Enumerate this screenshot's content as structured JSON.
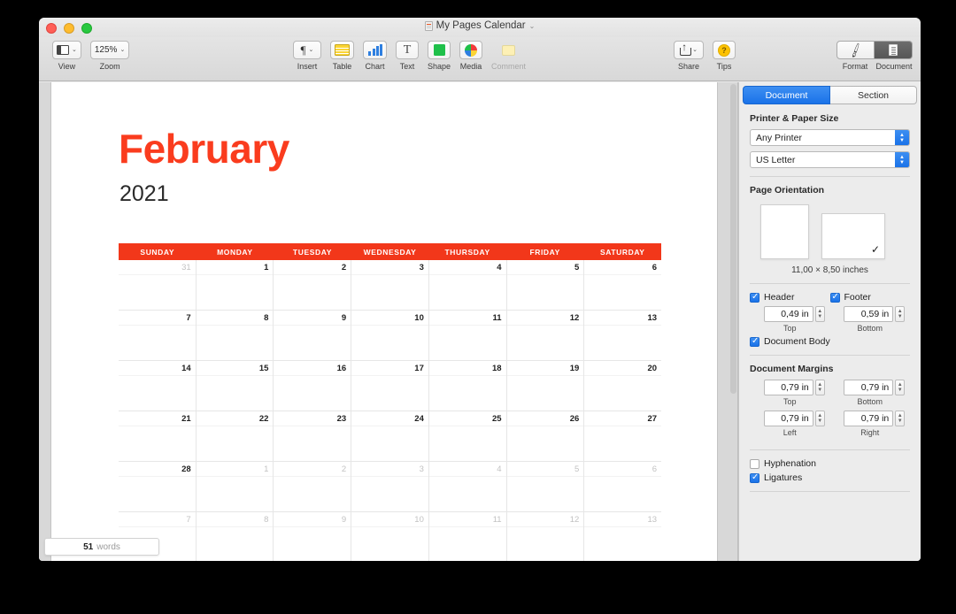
{
  "window": {
    "title": "My Pages Calendar",
    "title_chevron": "⌄"
  },
  "toolbar": {
    "left": [
      {
        "name": "view",
        "label": "View",
        "chevron": "⌄"
      },
      {
        "name": "zoom",
        "label": "Zoom",
        "value": "125%",
        "chevron": "⌄"
      }
    ],
    "center": [
      {
        "name": "insert",
        "label": "Insert",
        "chevron": "⌄"
      },
      {
        "name": "table",
        "label": "Table"
      },
      {
        "name": "chart",
        "label": "Chart"
      },
      {
        "name": "text",
        "label": "Text",
        "glyph": "T"
      },
      {
        "name": "shape",
        "label": "Shape"
      },
      {
        "name": "media",
        "label": "Media"
      },
      {
        "name": "comment",
        "label": "Comment",
        "dimmed": true
      }
    ],
    "right": [
      {
        "name": "share",
        "label": "Share",
        "chevron": "⌄"
      },
      {
        "name": "tips",
        "label": "Tips",
        "glyph": "?"
      }
    ],
    "inspector_toggle": {
      "format_label": "Format",
      "document_label": "Document",
      "active": "Document"
    }
  },
  "document": {
    "month": "February",
    "year": "2021",
    "weekdays": [
      "SUNDAY",
      "MONDAY",
      "TUESDAY",
      "WEDNESDAY",
      "THURSDAY",
      "FRIDAY",
      "SATURDAY"
    ],
    "weeks": [
      [
        {
          "n": "31",
          "other": true
        },
        {
          "n": "1"
        },
        {
          "n": "2"
        },
        {
          "n": "3"
        },
        {
          "n": "4"
        },
        {
          "n": "5"
        },
        {
          "n": "6"
        }
      ],
      [
        {
          "n": "7"
        },
        {
          "n": "8"
        },
        {
          "n": "9"
        },
        {
          "n": "10"
        },
        {
          "n": "11"
        },
        {
          "n": "12"
        },
        {
          "n": "13"
        }
      ],
      [
        {
          "n": "14"
        },
        {
          "n": "15"
        },
        {
          "n": "16"
        },
        {
          "n": "17"
        },
        {
          "n": "18"
        },
        {
          "n": "19"
        },
        {
          "n": "20"
        }
      ],
      [
        {
          "n": "21"
        },
        {
          "n": "22"
        },
        {
          "n": "23"
        },
        {
          "n": "24"
        },
        {
          "n": "25"
        },
        {
          "n": "26"
        },
        {
          "n": "27"
        }
      ],
      [
        {
          "n": "28"
        },
        {
          "n": "1",
          "other": true
        },
        {
          "n": "2",
          "other": true
        },
        {
          "n": "3",
          "other": true
        },
        {
          "n": "4",
          "other": true
        },
        {
          "n": "5",
          "other": true
        },
        {
          "n": "6",
          "other": true
        }
      ],
      [
        {
          "n": "7",
          "other": true
        },
        {
          "n": "8",
          "other": true
        },
        {
          "n": "9",
          "other": true
        },
        {
          "n": "10",
          "other": true
        },
        {
          "n": "11",
          "other": true
        },
        {
          "n": "12",
          "other": true
        },
        {
          "n": "13",
          "other": true
        }
      ]
    ],
    "accent_color": "#f2371a",
    "title_color": "#fa3c1e"
  },
  "wordcount": {
    "count": "51",
    "label": "words"
  },
  "sidebar": {
    "tabs": [
      {
        "label": "Document",
        "active": true
      },
      {
        "label": "Section",
        "active": false
      }
    ],
    "printer_section": {
      "title": "Printer & Paper Size",
      "printer": "Any Printer",
      "paper": "US Letter"
    },
    "orientation_section": {
      "title": "Page Orientation",
      "portrait_selected": false,
      "landscape_selected": true,
      "checkmark": "✓",
      "paper_size": "11,00 × 8,50 inches"
    },
    "header_footer": {
      "header_label": "Header",
      "header_checked": true,
      "header_value": "0,49 in",
      "header_sublabel": "Top",
      "footer_label": "Footer",
      "footer_checked": true,
      "footer_value": "0,59 in",
      "footer_sublabel": "Bottom",
      "document_body_label": "Document Body",
      "document_body_checked": true
    },
    "margins": {
      "title": "Document Margins",
      "cells": [
        {
          "value": "0,79 in",
          "label": "Top"
        },
        {
          "value": "0,79 in",
          "label": "Bottom"
        },
        {
          "value": "0,79 in",
          "label": "Left"
        },
        {
          "value": "0,79 in",
          "label": "Right"
        }
      ]
    },
    "options": {
      "hyphenation_label": "Hyphenation",
      "hyphenation_checked": false,
      "ligatures_label": "Ligatures",
      "ligatures_checked": true
    }
  }
}
